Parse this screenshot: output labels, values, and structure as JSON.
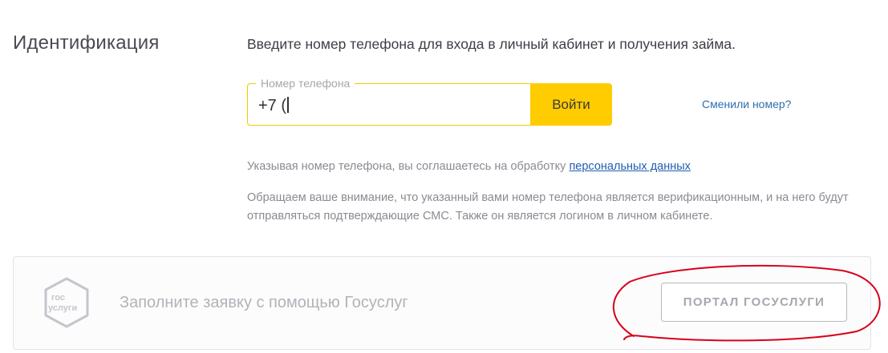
{
  "identification": {
    "title": "Идентификация",
    "intro": "Введите номер телефона для входа в личный кабинет и получения займа."
  },
  "phone_form": {
    "label": "Номер телефона",
    "value": "+7 (",
    "login_button": "Войти",
    "changed_number_link": "Сменили номер?"
  },
  "consent": {
    "text": "Указывая номер телефона, вы соглашаетесь на обработку",
    "link": "персональных данных"
  },
  "notice": {
    "text": "Обращаем ваше внимание, что указанный вами номер телефона является верификационным, и на него будут отправляться подтверждающие СМС. Также он является логином в личном кабинете."
  },
  "gosuslugi": {
    "logo_line1": "гос",
    "logo_line2": "услуги",
    "promo_text": "Заполните заявку с помощью Госуслуг",
    "portal_button": "ПОРТАЛ ГОСУСЛУГИ"
  },
  "colors": {
    "accent_yellow": "#ffcc00",
    "link_blue": "#2f6fb0",
    "annotation_red": "#d8001a"
  }
}
